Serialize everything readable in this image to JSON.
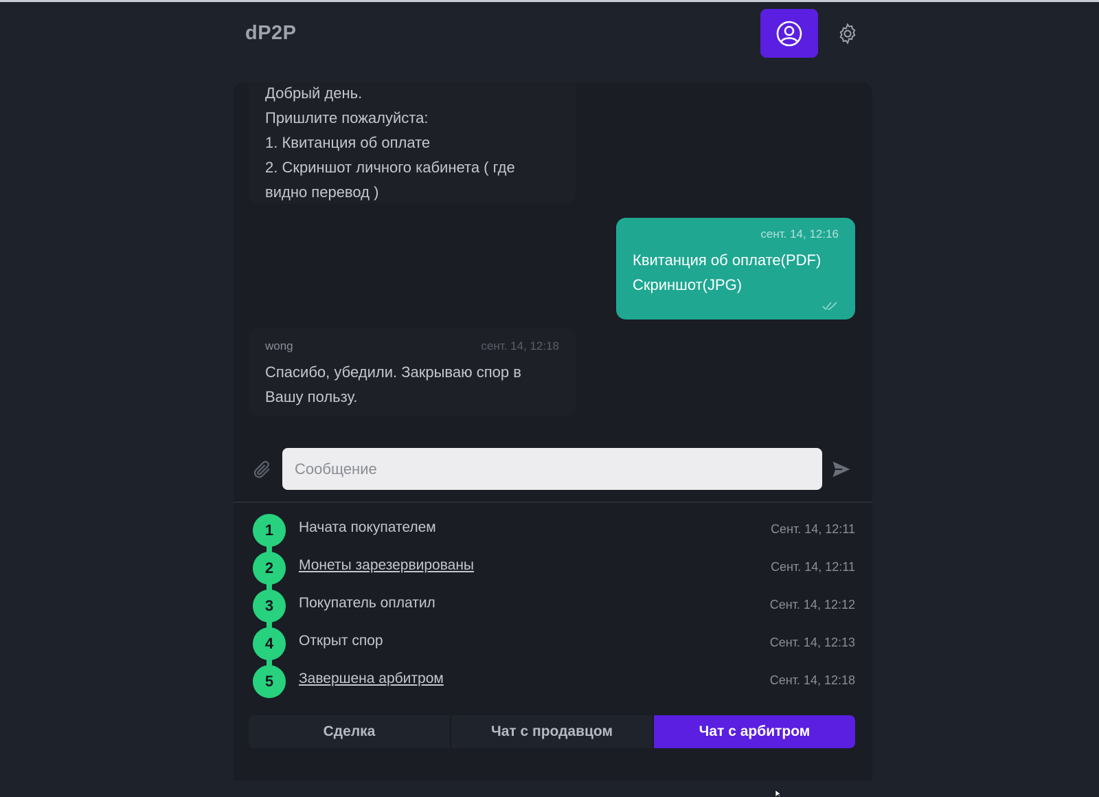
{
  "app": {
    "title": "dP2P"
  },
  "header": {
    "profile_icon": "user-circle-icon",
    "settings_icon": "gear-icon"
  },
  "colors": {
    "accent": "#5a1fe0",
    "outgoing_bubble": "#1fa792",
    "step_badge": "#27d17e",
    "background": "#1e222b"
  },
  "chat": {
    "messages": [
      {
        "direction": "in",
        "text": "Добрый день.\nПришлите пожалуйста:\n1. Квитанция об оплате\n2. Скриншот личного кабинета ( где видно перевод )"
      },
      {
        "direction": "out",
        "time": "сент. 14, 12:16",
        "text": "Квитанция об оплате(PDF)\nСкриншот(JPG)"
      },
      {
        "direction": "in",
        "author": "wong",
        "time": "сент. 14, 12:18",
        "text": "Спасибо, убедили. Закрываю спор в Вашу пользу."
      }
    ]
  },
  "composer": {
    "value": "",
    "placeholder": "Сообщение"
  },
  "steps": [
    {
      "num": "1",
      "label": "Начата покупателем",
      "time": "Сент. 14, 12:11",
      "link": false
    },
    {
      "num": "2",
      "label": "Монеты зарезервированы",
      "time": "Сент. 14, 12:11",
      "link": true
    },
    {
      "num": "3",
      "label": "Покупатель оплатил",
      "time": "Сент. 14, 12:12",
      "link": false
    },
    {
      "num": "4",
      "label": "Открыт спор",
      "time": "Сент. 14, 12:13",
      "link": false
    },
    {
      "num": "5",
      "label": "Завершена арбитром",
      "time": "Сент. 14, 12:18",
      "link": true
    }
  ],
  "tabs": [
    {
      "label": "Сделка",
      "active": false
    },
    {
      "label": "Чат с продавцом",
      "active": false
    },
    {
      "label": "Чат с арбитром",
      "active": true
    }
  ]
}
